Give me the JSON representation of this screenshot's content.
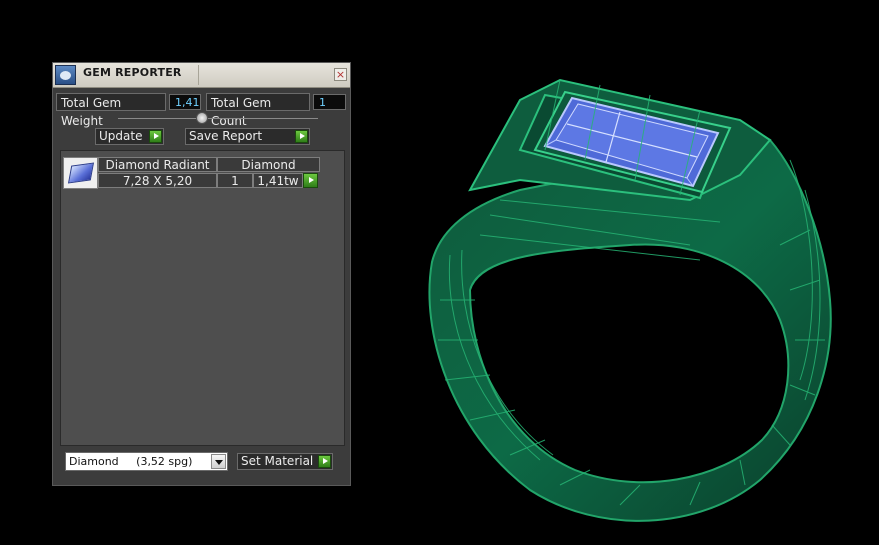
{
  "window": {
    "title": "GEM REPORTER",
    "close_symbol": "×",
    "app_icon": "gem-reporter-icon"
  },
  "stats": {
    "total_gem_weight_label": "Total Gem Weight",
    "total_gem_weight_value": "1,41",
    "total_gem_count_label": "Total Gem Count",
    "total_gem_count_value": "1"
  },
  "toolbar": {
    "update_label": "Update",
    "save_report_label": "Save Report"
  },
  "gem_list": {
    "columns": [
      "Diamond Radiant",
      "Diamond"
    ],
    "rows": [
      {
        "icon": "radiant-diamond-icon",
        "shape": "Diamond Radiant",
        "material": "Diamond",
        "size": "7,28 X 5,20",
        "count": "1",
        "weight": "1,41tw"
      }
    ]
  },
  "material": {
    "selected": "Diamond     (3,52 spg)",
    "set_material_label": "Set Material"
  },
  "colors": {
    "ring_wire": "#1e8f5c",
    "ring_fill": "#0b4a33",
    "gem_fill": "#4f6ad8",
    "gem_wire": "#b9c8ff",
    "accent_green": "#4fb62a",
    "value_blue": "#6fd1ff"
  }
}
